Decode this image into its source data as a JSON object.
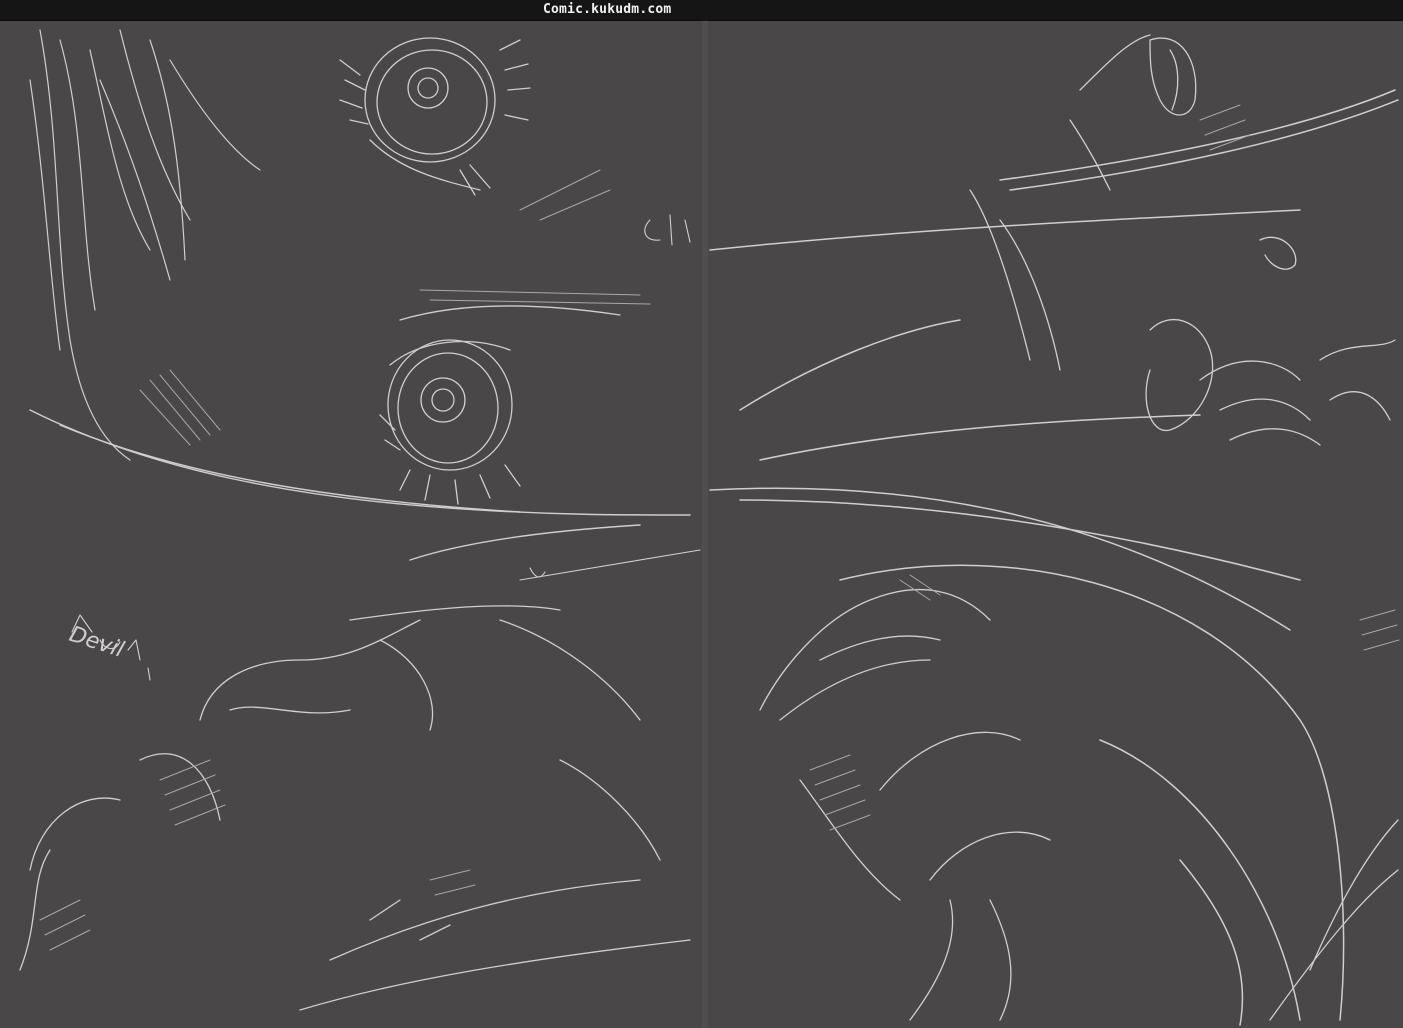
{
  "header": {
    "site_label": "Comic.kukudm.com"
  },
  "canvas": {
    "background_color": "#4a4748",
    "stroke_color": "#cfcfcf",
    "topbar_color": "#151515"
  },
  "annotations": {
    "scribble_left": "Devil"
  }
}
